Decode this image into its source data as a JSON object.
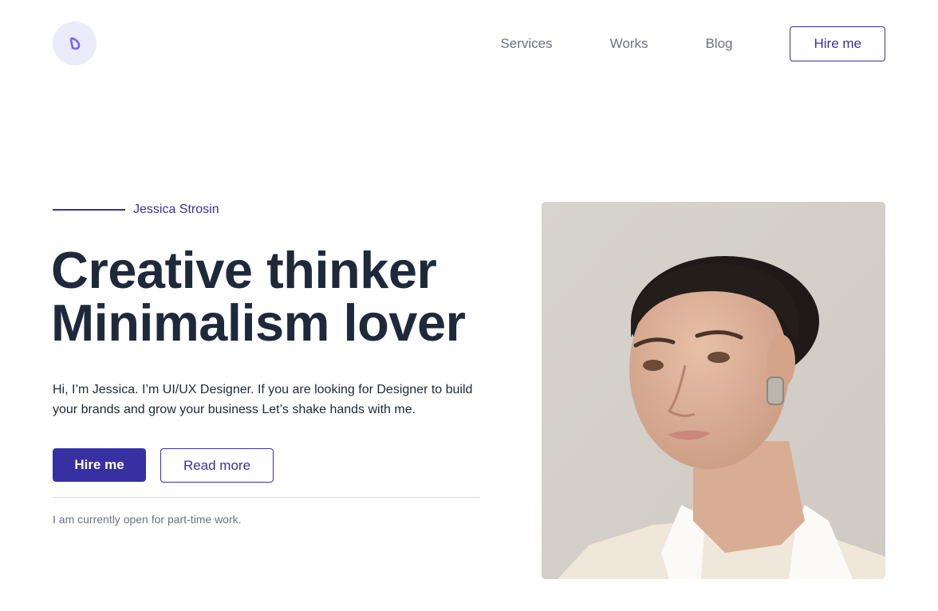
{
  "header": {
    "logo_icon": "d-monogram-icon",
    "nav": [
      {
        "label": "Services"
      },
      {
        "label": "Works"
      },
      {
        "label": "Blog"
      }
    ],
    "cta_label": "Hire me"
  },
  "hero": {
    "name": "Jessica Strosin",
    "headline_line1": "Creative thinker",
    "headline_line2": "Minimalism lover",
    "intro": "Hi, I’m Jessica. I’m UI/UX Designer. If you are looking for Designer to build your brands and grow your business Let’s shake hands with me.",
    "primary_label": "Hire me",
    "secondary_label": "Read more",
    "availability": "I am currently open for part-time work.",
    "photo": "portrait-photo"
  },
  "colors": {
    "accent": "#3730a3",
    "heading": "#1e293b",
    "muted": "#6b7280",
    "logo_bg": "#ecebfb"
  }
}
